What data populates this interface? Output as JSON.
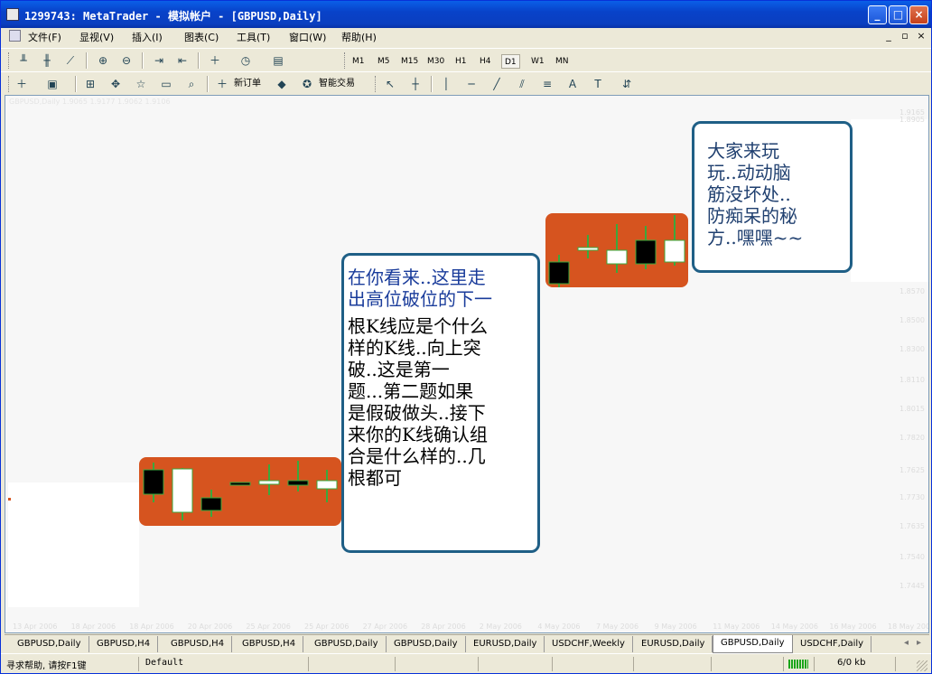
{
  "window": {
    "title": "1299743: MetaTrader - 模拟帐户 - [GBPUSD,Daily]",
    "controls": [
      "_",
      "□",
      "×"
    ]
  },
  "menu": {
    "items": [
      "文件(F)",
      "显视(V)",
      "插入(I)",
      "图表(C)",
      "工具(T)",
      "窗口(W)",
      "帮助(H)"
    ],
    "mdi_controls": [
      "_",
      "▫",
      "×"
    ]
  },
  "toolbar": {
    "timeframes": [
      "M1",
      "M5",
      "M15",
      "M30",
      "H1",
      "H4",
      "D1",
      "W1",
      "MN"
    ],
    "active_timeframe": "D1",
    "new_order_label": "新订单",
    "expert_label": "智能交易",
    "text_tool_label": "A",
    "label_tool_label": "T"
  },
  "chart": {
    "header": "GBPUSD,Daily  1.9065 1.9177 1.9062 1.9106",
    "price_labels": [
      "1.9165",
      "1.8905",
      "1.8570",
      "1.8500",
      "1.8300",
      "1.8110",
      "1.8015",
      "1.7820",
      "1.7625",
      "1.7730",
      "1.7635",
      "1.7540",
      "1.7445"
    ],
    "date_labels": [
      "13 Apr 2006",
      "18 Apr 2006",
      "18 Apr 2006",
      "20 Apr 2006",
      "25 Apr 2006",
      "25 Apr 2006",
      "27 Apr 2006",
      "28 Apr 2006",
      "2 May 2006",
      "4 May 2006",
      "7 May 2006",
      "9 May 2006",
      "11 May 2006",
      "14 May 2006",
      "16 May 2006",
      "18 May 2006"
    ],
    "colors": {
      "panel": "#d6541f",
      "border": "#1f5f86",
      "wick": "#3ca83c"
    }
  },
  "callouts": {
    "left": {
      "blue_lines": [
        "在你看来..这里走",
        "出高位破位的下一"
      ],
      "black_lines": [
        "根K线应是个什么",
        "样的K线..向上突",
        "破..这是第一",
        "题...第二题如果",
        "是假破做头..接下",
        "来你的K线确认组",
        "合是什么样的..几",
        "根都可"
      ]
    },
    "right": {
      "lines": [
        "大家来玩",
        "玩..动动脑",
        "筋没坏处..",
        "防痴呆的秘",
        "方..嘿嘿~~"
      ]
    }
  },
  "tabs": {
    "items": [
      "GBPUSD,Daily",
      "GBPUSD,H4",
      "GBPUSD,H4",
      "GBPUSD,H4",
      "GBPUSD,Daily",
      "GBPUSD,Daily",
      "EURUSD,Daily",
      "USDCHF,Weekly",
      "EURUSD,Daily",
      "GBPUSD,Daily",
      "USDCHF,Daily"
    ],
    "active_index": 9,
    "arrows": [
      "◂",
      "▸"
    ]
  },
  "status": {
    "help": "寻求帮助, 请按F1键",
    "profile": "Default",
    "traffic": "6/0 kb"
  }
}
